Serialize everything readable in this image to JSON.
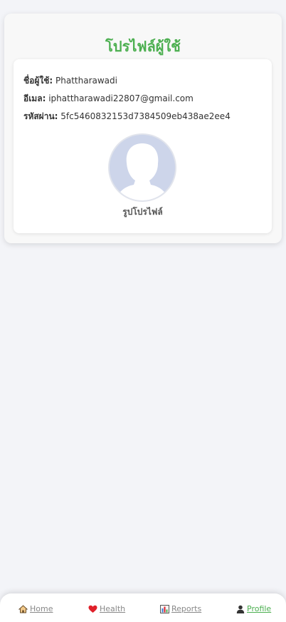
{
  "page": {
    "title": "โปรไฟล์ผู้ใช้"
  },
  "profile": {
    "username_label": "ชื่อผู้ใช้:",
    "username_value": "Phattharawadi",
    "email_label": "อีเมล:",
    "email_value": "iphattharawadi22807@gmail.com",
    "password_label": "รหัสผ่าน:",
    "password_value": "5fc5460832153d7384509eb438ae2ee4",
    "avatar_caption": "รูปโปรไฟล์"
  },
  "nav": {
    "items": [
      {
        "label": "Home",
        "icon": "house-icon"
      },
      {
        "label": "Health",
        "icon": "heart-icon"
      },
      {
        "label": "Reports",
        "icon": "bar-chart-icon"
      },
      {
        "label": "Profile",
        "icon": "person-icon",
        "active": true
      }
    ]
  },
  "colors": {
    "accent": "#4caf50",
    "background": "#f3f4f8",
    "card": "#ffffff",
    "avatar_bg": "#cdd5ea"
  }
}
